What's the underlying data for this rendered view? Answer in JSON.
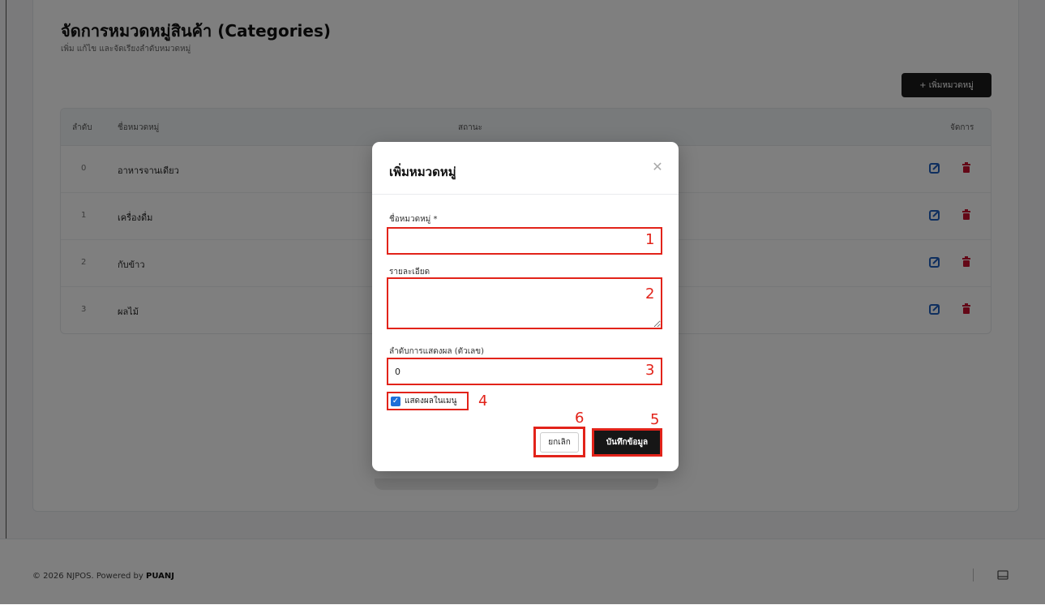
{
  "page": {
    "title": "จัดการหมวดหมู่สินค้า (Categories)",
    "subtitle": "เพิ่ม แก้ไข และจัดเรียงลำดับหมวดหมู่",
    "add_button": {
      "icon": "plus-icon",
      "label": "+ เพิ่มหมวดหมู่"
    }
  },
  "table": {
    "headers": {
      "order": "ลำดับ",
      "name": "ชื่อหมวดหมู่",
      "status": "สถานะ",
      "actions": "จัดการ"
    },
    "rows": [
      {
        "order": "0",
        "name": "อาหารจานเดียว"
      },
      {
        "order": "1",
        "name": "เครื่องดื่ม"
      },
      {
        "order": "2",
        "name": "กับข้าว"
      },
      {
        "order": "3",
        "name": "ผลไม้"
      }
    ],
    "action_icons": {
      "edit": "edit-icon",
      "delete": "trash-icon"
    },
    "colors": {
      "edit": "#1f5fbf",
      "delete": "#c8102e"
    }
  },
  "footer": {
    "prefix": "© 2026 NJPOS. Powered by ",
    "brand": "PUANJ",
    "icon": "panel-icon"
  },
  "modal": {
    "title": "เพิ่มหมวดหมู่",
    "close_icon": "close-icon",
    "fields": {
      "name": {
        "label": "ชื่อหมวดหมู่ *",
        "value": "",
        "marker": "1"
      },
      "description": {
        "label": "รายละเอียด",
        "value": "",
        "marker": "2"
      },
      "display_order": {
        "label": "ลำดับการแสดงผล (ตัวเลข)",
        "value": "0",
        "marker": "3"
      }
    },
    "show_in_menu": {
      "label": "แสดงผลในเมนู",
      "checked": true,
      "marker": "4"
    },
    "cancel_button": {
      "label": "ยกเลิก",
      "marker": "6"
    },
    "save_button": {
      "label": "บันทึกข้อมูล",
      "marker": "5"
    }
  },
  "colors": {
    "annotation": "#e2231a",
    "overlay": "rgba(0,0,0,0.5)",
    "primary_button": "#161616",
    "checkbox": "#1e6fd9"
  }
}
